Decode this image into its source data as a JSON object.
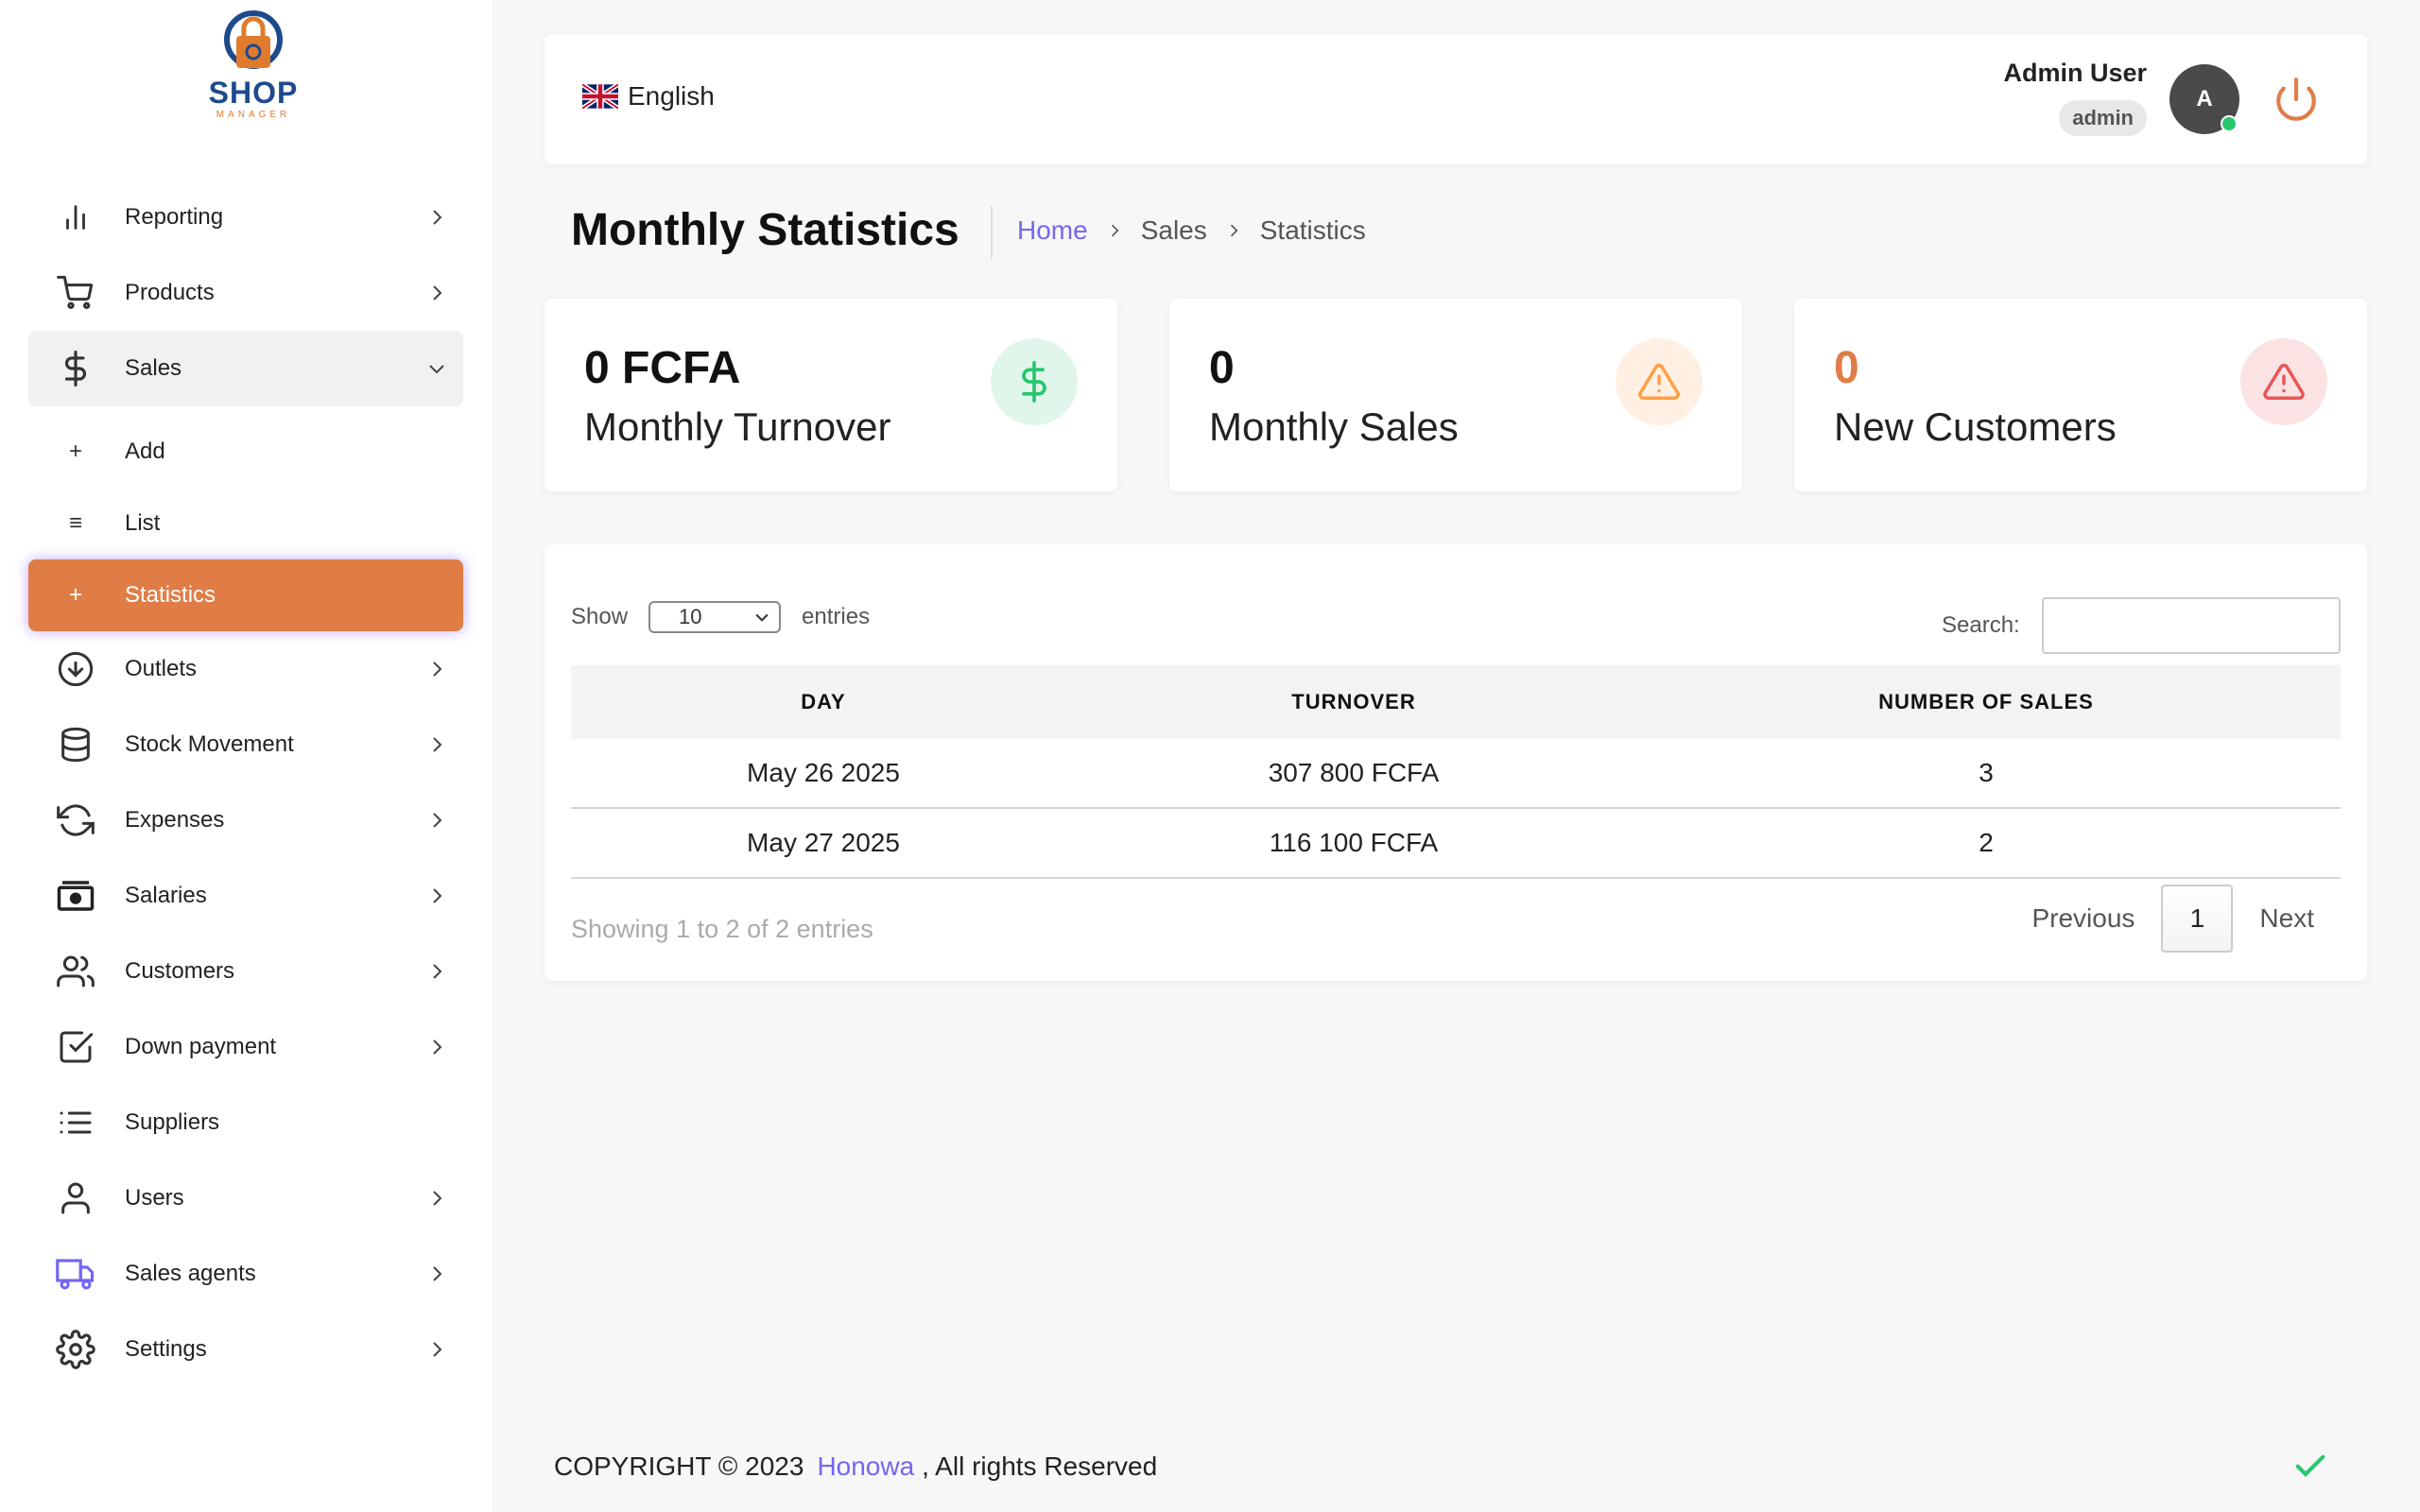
{
  "logo": {
    "text": "SHOP",
    "sub": "MANAGER"
  },
  "sidebar": {
    "items": [
      {
        "label": "Reporting",
        "icon": "bar-chart-icon"
      },
      {
        "label": "Products",
        "icon": "shopping-cart-icon"
      },
      {
        "label": "Sales",
        "icon": "dollar-icon",
        "open": true
      },
      {
        "label": "Outlets",
        "icon": "arrow-down-circle-icon"
      },
      {
        "label": "Stock Movement",
        "icon": "database-icon"
      },
      {
        "label": "Expenses",
        "icon": "refresh-icon"
      },
      {
        "label": "Salaries",
        "icon": "cash-icon"
      },
      {
        "label": "Customers",
        "icon": "users-icon"
      },
      {
        "label": "Down payment",
        "icon": "check-square-icon"
      },
      {
        "label": "Suppliers",
        "icon": "list-icon"
      },
      {
        "label": "Users",
        "icon": "user-icon"
      },
      {
        "label": "Sales agents",
        "icon": "truck-icon"
      },
      {
        "label": "Settings",
        "icon": "gear-icon"
      }
    ],
    "sales_sub": [
      {
        "label": "Add",
        "icon": "+"
      },
      {
        "label": "List",
        "icon": "≡"
      },
      {
        "label": "Statistics",
        "icon": "+",
        "active": true
      }
    ]
  },
  "header": {
    "language": "English",
    "user_name": "Admin User",
    "user_role": "admin",
    "avatar_letter": "A"
  },
  "page": {
    "title": "Monthly Statistics",
    "breadcrumb": [
      "Home",
      "Sales",
      "Statistics"
    ]
  },
  "stats": [
    {
      "value": "0 FCFA",
      "caption": "Monthly Turnover",
      "icon": "dollar-icon",
      "color": "#28c76f"
    },
    {
      "value": "0",
      "caption": "Monthly Sales",
      "icon": "warning-icon",
      "color": "#ff9f43"
    },
    {
      "value": "0",
      "caption": "New Customers",
      "icon": "alert-triangle-icon",
      "color": "#ea5455"
    }
  ],
  "table": {
    "show_label": "Show",
    "entries_label": "entries",
    "page_size": "10",
    "search_label": "Search:",
    "search_value": "",
    "columns": [
      "DAY",
      "TURNOVER",
      "NUMBER OF SALES"
    ],
    "rows": [
      [
        "May 26 2025",
        "307 800 FCFA",
        "3"
      ],
      [
        "May 27 2025",
        "116 100 FCFA",
        "2"
      ]
    ],
    "info": "Showing 1 to 2 of 2 entries",
    "previous": "Previous",
    "current_page": "1",
    "next": "Next"
  },
  "footer": {
    "prefix": "COPYRIGHT © 2023",
    "brand": "Honowa",
    "suffix": ", All rights Reserved"
  },
  "colors": {
    "accent": "#e07d46",
    "link": "#7367f0"
  }
}
